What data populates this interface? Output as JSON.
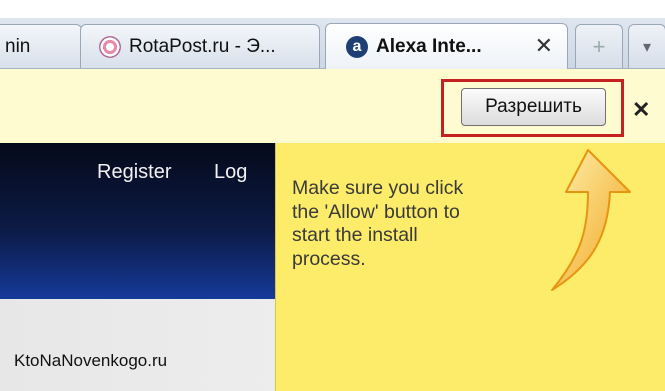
{
  "tabs": [
    {
      "label": "nin"
    },
    {
      "label": "RotaPost.ru - Э..."
    },
    {
      "label": "Alexa Inte..."
    }
  ],
  "tab_close_glyph": "✕",
  "new_tab_glyph": "+",
  "tab_list_glyph": "▾",
  "notification": {
    "allow_button": "Разрешить",
    "close_glyph": "✕"
  },
  "site": {
    "nav_register": "Register",
    "nav_login": "Log",
    "watermark": "KtoNaNovenkogo.ru"
  },
  "tooltip": {
    "text": "Make sure you click\nthe 'Allow' button to\nstart the install\nprocess."
  },
  "colors": {
    "tooltip_bg": "#fcec6a",
    "notification_bg": "#fffbd1",
    "highlight_border": "#c62020",
    "arrow": "#f0a21a"
  }
}
